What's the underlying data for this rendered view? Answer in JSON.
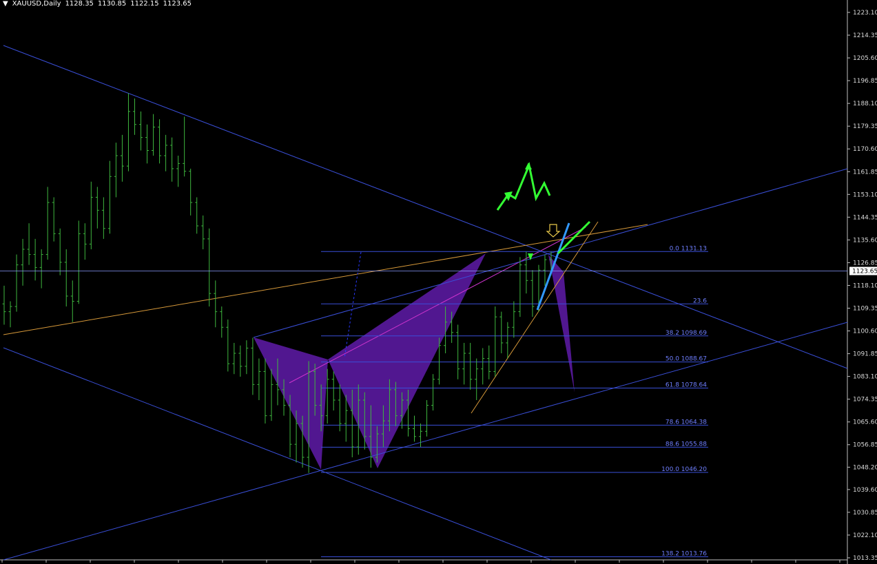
{
  "header": {
    "symbol": "XAUUSD,Daily",
    "open": "1128.35",
    "high": "1130.85",
    "low": "1122.15",
    "close": "1123.65"
  },
  "chart_data": {
    "type": "candlestick",
    "symbol": "XAUUSD",
    "timeframe": "Daily",
    "ylim": [
      1013.35,
      1225.0
    ],
    "y_ticks": [
      "1223.10",
      "1214.35",
      "1205.60",
      "1196.85",
      "1188.10",
      "1179.35",
      "1170.60",
      "1161.85",
      "1153.10",
      "1144.35",
      "1135.60",
      "1126.85",
      "1118.10",
      "1109.35",
      "1100.60",
      "1091.85",
      "1083.10",
      "1074.35",
      "1065.60",
      "1056.85",
      "1048.20",
      "1039.60",
      "1030.85",
      "1022.10",
      "1013.35"
    ],
    "current_price": "1123.65",
    "fib_levels": [
      {
        "level": "0.0",
        "price": "1131.13",
        "value": 1131.13
      },
      {
        "level": "23.6",
        "price": "",
        "value": 1111.0
      },
      {
        "level": "38.2",
        "price": "1098.69",
        "value": 1098.69
      },
      {
        "level": "50.0",
        "price": "1088.67",
        "value": 1088.67
      },
      {
        "level": "61.8",
        "price": "1078.64",
        "value": 1078.64
      },
      {
        "level": "78.6",
        "price": "1064.38",
        "value": 1064.38
      },
      {
        "level": "88.6",
        "price": "1055.88",
        "value": 1055.88
      },
      {
        "level": "100.0",
        "price": "1046.20",
        "value": 1046.2
      },
      {
        "level": "138.2",
        "price": "1013.76",
        "value": 1013.76
      }
    ],
    "bars": [
      {
        "o": 1111,
        "h": 1118,
        "l": 1103,
        "c": 1108
      },
      {
        "o": 1108,
        "h": 1112,
        "l": 1102,
        "c": 1110
      },
      {
        "o": 1110,
        "h": 1130,
        "l": 1108,
        "c": 1126
      },
      {
        "o": 1126,
        "h": 1136,
        "l": 1118,
        "c": 1132
      },
      {
        "o": 1132,
        "h": 1142,
        "l": 1126,
        "c": 1130
      },
      {
        "o": 1130,
        "h": 1136,
        "l": 1120,
        "c": 1125
      },
      {
        "o": 1125,
        "h": 1132,
        "l": 1117,
        "c": 1130
      },
      {
        "o": 1130,
        "h": 1156,
        "l": 1128,
        "c": 1150
      },
      {
        "o": 1150,
        "h": 1152,
        "l": 1135,
        "c": 1138
      },
      {
        "o": 1138,
        "h": 1140,
        "l": 1122,
        "c": 1127
      },
      {
        "o": 1127,
        "h": 1132,
        "l": 1110,
        "c": 1114
      },
      {
        "o": 1114,
        "h": 1120,
        "l": 1104,
        "c": 1112
      },
      {
        "o": 1112,
        "h": 1143,
        "l": 1111,
        "c": 1138
      },
      {
        "o": 1138,
        "h": 1142,
        "l": 1128,
        "c": 1134
      },
      {
        "o": 1134,
        "h": 1158,
        "l": 1132,
        "c": 1152
      },
      {
        "o": 1152,
        "h": 1156,
        "l": 1140,
        "c": 1147
      },
      {
        "o": 1147,
        "h": 1152,
        "l": 1136,
        "c": 1140
      },
      {
        "o": 1140,
        "h": 1166,
        "l": 1138,
        "c": 1160
      },
      {
        "o": 1160,
        "h": 1173,
        "l": 1152,
        "c": 1168
      },
      {
        "o": 1168,
        "h": 1176,
        "l": 1158,
        "c": 1164
      },
      {
        "o": 1164,
        "h": 1192,
        "l": 1162,
        "c": 1185
      },
      {
        "o": 1185,
        "h": 1190,
        "l": 1176,
        "c": 1180
      },
      {
        "o": 1180,
        "h": 1185,
        "l": 1170,
        "c": 1175
      },
      {
        "o": 1175,
        "h": 1180,
        "l": 1165,
        "c": 1170
      },
      {
        "o": 1170,
        "h": 1184,
        "l": 1168,
        "c": 1179
      },
      {
        "o": 1179,
        "h": 1182,
        "l": 1165,
        "c": 1168
      },
      {
        "o": 1168,
        "h": 1176,
        "l": 1162,
        "c": 1172
      },
      {
        "o": 1172,
        "h": 1175,
        "l": 1158,
        "c": 1163
      },
      {
        "o": 1163,
        "h": 1168,
        "l": 1156,
        "c": 1165
      },
      {
        "o": 1165,
        "h": 1183,
        "l": 1160,
        "c": 1162
      },
      {
        "o": 1162,
        "h": 1163,
        "l": 1145,
        "c": 1150
      },
      {
        "o": 1150,
        "h": 1152,
        "l": 1138,
        "c": 1141
      },
      {
        "o": 1141,
        "h": 1145,
        "l": 1132,
        "c": 1136
      },
      {
        "o": 1136,
        "h": 1140,
        "l": 1110,
        "c": 1115
      },
      {
        "o": 1115,
        "h": 1120,
        "l": 1102,
        "c": 1108
      },
      {
        "o": 1108,
        "h": 1110,
        "l": 1098,
        "c": 1102
      },
      {
        "o": 1102,
        "h": 1105,
        "l": 1085,
        "c": 1088
      },
      {
        "o": 1088,
        "h": 1096,
        "l": 1084,
        "c": 1092
      },
      {
        "o": 1092,
        "h": 1095,
        "l": 1083,
        "c": 1087
      },
      {
        "o": 1087,
        "h": 1097,
        "l": 1084,
        "c": 1094
      },
      {
        "o": 1094,
        "h": 1098,
        "l": 1076,
        "c": 1080
      },
      {
        "o": 1080,
        "h": 1090,
        "l": 1074,
        "c": 1085
      },
      {
        "o": 1085,
        "h": 1090,
        "l": 1065,
        "c": 1068
      },
      {
        "o": 1068,
        "h": 1086,
        "l": 1066,
        "c": 1080
      },
      {
        "o": 1080,
        "h": 1090,
        "l": 1072,
        "c": 1078
      },
      {
        "o": 1078,
        "h": 1082,
        "l": 1068,
        "c": 1072
      },
      {
        "o": 1072,
        "h": 1076,
        "l": 1052,
        "c": 1057
      },
      {
        "o": 1057,
        "h": 1070,
        "l": 1050,
        "c": 1065
      },
      {
        "o": 1065,
        "h": 1068,
        "l": 1048,
        "c": 1052
      },
      {
        "o": 1052,
        "h": 1089,
        "l": 1046,
        "c": 1085
      },
      {
        "o": 1085,
        "h": 1088,
        "l": 1068,
        "c": 1072
      },
      {
        "o": 1072,
        "h": 1080,
        "l": 1062,
        "c": 1068
      },
      {
        "o": 1068,
        "h": 1086,
        "l": 1065,
        "c": 1082
      },
      {
        "o": 1082,
        "h": 1085,
        "l": 1070,
        "c": 1074
      },
      {
        "o": 1074,
        "h": 1080,
        "l": 1062,
        "c": 1065
      },
      {
        "o": 1065,
        "h": 1076,
        "l": 1058,
        "c": 1070
      },
      {
        "o": 1070,
        "h": 1078,
        "l": 1052,
        "c": 1056
      },
      {
        "o": 1056,
        "h": 1080,
        "l": 1053,
        "c": 1074
      },
      {
        "o": 1074,
        "h": 1077,
        "l": 1055,
        "c": 1060
      },
      {
        "o": 1060,
        "h": 1072,
        "l": 1048,
        "c": 1052
      },
      {
        "o": 1052,
        "h": 1064,
        "l": 1050,
        "c": 1061
      },
      {
        "o": 1061,
        "h": 1072,
        "l": 1056,
        "c": 1066
      },
      {
        "o": 1066,
        "h": 1082,
        "l": 1062,
        "c": 1078
      },
      {
        "o": 1078,
        "h": 1081,
        "l": 1064,
        "c": 1068
      },
      {
        "o": 1068,
        "h": 1077,
        "l": 1063,
        "c": 1074
      },
      {
        "o": 1074,
        "h": 1078,
        "l": 1060,
        "c": 1063
      },
      {
        "o": 1063,
        "h": 1068,
        "l": 1058,
        "c": 1060
      },
      {
        "o": 1060,
        "h": 1065,
        "l": 1056,
        "c": 1062
      },
      {
        "o": 1062,
        "h": 1074,
        "l": 1060,
        "c": 1072
      },
      {
        "o": 1072,
        "h": 1084,
        "l": 1070,
        "c": 1082
      },
      {
        "o": 1082,
        "h": 1098,
        "l": 1080,
        "c": 1095
      },
      {
        "o": 1095,
        "h": 1110,
        "l": 1092,
        "c": 1104
      },
      {
        "o": 1104,
        "h": 1108,
        "l": 1096,
        "c": 1100
      },
      {
        "o": 1100,
        "h": 1103,
        "l": 1082,
        "c": 1086
      },
      {
        "o": 1086,
        "h": 1096,
        "l": 1080,
        "c": 1092
      },
      {
        "o": 1092,
        "h": 1096,
        "l": 1078,
        "c": 1082
      },
      {
        "o": 1082,
        "h": 1090,
        "l": 1074,
        "c": 1086
      },
      {
        "o": 1086,
        "h": 1094,
        "l": 1080,
        "c": 1090
      },
      {
        "o": 1090,
        "h": 1095,
        "l": 1082,
        "c": 1085
      },
      {
        "o": 1085,
        "h": 1110,
        "l": 1083,
        "c": 1106
      },
      {
        "o": 1106,
        "h": 1108,
        "l": 1092,
        "c": 1096
      },
      {
        "o": 1096,
        "h": 1104,
        "l": 1090,
        "c": 1102
      },
      {
        "o": 1102,
        "h": 1112,
        "l": 1098,
        "c": 1108
      },
      {
        "o": 1108,
        "h": 1129,
        "l": 1106,
        "c": 1126
      },
      {
        "o": 1126,
        "h": 1131,
        "l": 1115,
        "c": 1120
      },
      {
        "o": 1120,
        "h": 1124,
        "l": 1106,
        "c": 1110
      },
      {
        "o": 1110,
        "h": 1126,
        "l": 1108,
        "c": 1124
      },
      {
        "o": 1124,
        "h": 1130,
        "l": 1118,
        "c": 1128
      },
      {
        "o": 1128,
        "h": 1131,
        "l": 1122,
        "c": 1124
      }
    ]
  },
  "colors": {
    "background": "#000000",
    "bar": "#3fb83f",
    "trendline": "#3a4fd8",
    "fib": "#3a4fd8",
    "pattern_fill": "#5a1aa0",
    "pattern_line": "#cc33cc",
    "orange_line": "#d89a3a",
    "green_arrow": "#33ff33",
    "cyan_arrow": "#3399ff",
    "price_box": "#ffffff"
  }
}
